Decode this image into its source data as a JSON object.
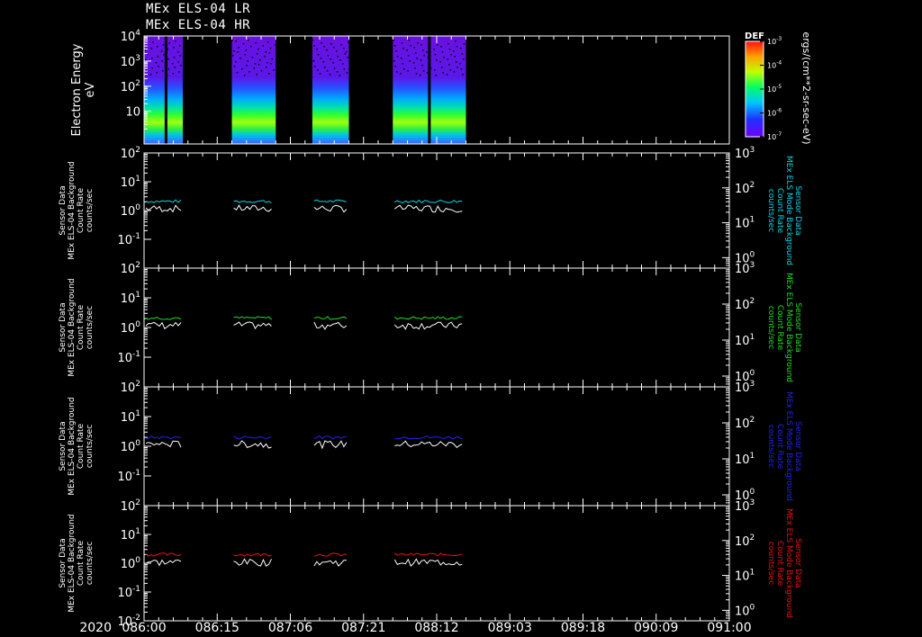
{
  "header": {
    "line1": "MEx ELS-04 LR",
    "line2": "MEx ELS-04 HR"
  },
  "colorbar": {
    "label": "DEF",
    "unit_label": "ergs/(cm**2-sr-sec-eV)",
    "ticks": [
      {
        "base": "10",
        "exp": "-3"
      },
      {
        "base": "10",
        "exp": "-4"
      },
      {
        "base": "10",
        "exp": "-5"
      },
      {
        "base": "10",
        "exp": "-6"
      },
      {
        "base": "10",
        "exp": "-7"
      }
    ]
  },
  "x_axis": {
    "year_label": "2020",
    "ticks": [
      "086:00",
      "086:15",
      "087:06",
      "087:21",
      "088:12",
      "089:03",
      "089:18",
      "090:09",
      "091:00"
    ]
  },
  "chart_data": [
    {
      "type": "heatmap",
      "name": "spectrogram",
      "ylabel_lines": [
        "Electron Energy",
        "eV"
      ],
      "y_ticks": [
        {
          "base": "10",
          "exp": "4"
        },
        {
          "base": "10",
          "exp": "3"
        },
        {
          "base": "10",
          "exp": "2"
        },
        {
          "base": "10",
          "exp": ""
        }
      ],
      "data_blocks": [
        [
          0.0,
          0.53
        ],
        [
          1.2,
          1.8
        ],
        [
          2.3,
          2.8
        ],
        [
          3.4,
          4.4
        ]
      ],
      "gaps_within": [
        0.3,
        3.9
      ]
    },
    {
      "type": "line",
      "name": "panel-cyan",
      "color": "#00d8e8",
      "left_label_lines": [
        "Sensor Data",
        "MEx ELS-04 Background",
        "Count Rate",
        "counts/sec"
      ],
      "right_label_lines": [
        "Sensor Data",
        "MEx ELS Mode Background",
        "Count Rate",
        "counts/sec"
      ],
      "left_ticks": [
        {
          "base": "10",
          "exp": "2"
        },
        {
          "base": "10",
          "exp": "1"
        },
        {
          "base": "10",
          "exp": "0"
        },
        {
          "base": "10",
          "exp": "-1"
        }
      ],
      "right_ticks": [
        {
          "base": "10",
          "exp": "3"
        },
        {
          "base": "10",
          "exp": "2"
        },
        {
          "base": "10",
          "exp": "1"
        },
        {
          "base": "10",
          "exp": "0"
        }
      ],
      "ylim_left": [
        0.01,
        100
      ],
      "level_colored": 2.1,
      "level_white": 1.2
    },
    {
      "type": "line",
      "name": "panel-green",
      "color": "#22dd22",
      "left_label_lines": [
        "Sensor Data",
        "MEx ELS-04 Background",
        "Count Rate",
        "counts/sec"
      ],
      "right_label_lines": [
        "Sensor Data",
        "MEx ELS Mode Background",
        "Count Rate",
        "counts/sec"
      ],
      "left_ticks": [
        {
          "base": "10",
          "exp": "2"
        },
        {
          "base": "10",
          "exp": "1"
        },
        {
          "base": "10",
          "exp": "0"
        },
        {
          "base": "10",
          "exp": "-1"
        }
      ],
      "right_ticks": [
        {
          "base": "10",
          "exp": "3"
        },
        {
          "base": "10",
          "exp": "2"
        },
        {
          "base": "10",
          "exp": "1"
        },
        {
          "base": "10",
          "exp": "0"
        }
      ],
      "ylim_left": [
        0.01,
        100
      ],
      "level_colored": 2.1,
      "level_white": 1.2
    },
    {
      "type": "line",
      "name": "panel-blue",
      "color": "#2222ee",
      "left_label_lines": [
        "Sensor Data",
        "MEx ELS-04 Background",
        "Count Rate",
        "counts/sec"
      ],
      "right_label_lines": [
        "Sensor Data",
        "MEx ELS Mode Background",
        "Count Rate",
        "counts/sec"
      ],
      "left_ticks": [
        {
          "base": "10",
          "exp": "2"
        },
        {
          "base": "10",
          "exp": "1"
        },
        {
          "base": "10",
          "exp": "0"
        },
        {
          "base": "10",
          "exp": "-1"
        }
      ],
      "right_ticks": [
        {
          "base": "10",
          "exp": "3"
        },
        {
          "base": "10",
          "exp": "2"
        },
        {
          "base": "10",
          "exp": "1"
        },
        {
          "base": "10",
          "exp": "0"
        }
      ],
      "ylim_left": [
        0.01,
        100
      ],
      "level_colored": 2.0,
      "level_white": 1.2
    },
    {
      "type": "line",
      "name": "panel-red",
      "color": "#ee1111",
      "left_label_lines": [
        "Sensor Data",
        "MEx ELS-04 Background",
        "Count Rate",
        "counts/sec"
      ],
      "right_label_lines": [
        "Sensor Data",
        "MEx ELS Mode Background",
        "Count Rate",
        "counts/sec"
      ],
      "left_ticks": [
        {
          "base": "10",
          "exp": "2"
        },
        {
          "base": "10",
          "exp": "1"
        },
        {
          "base": "10",
          "exp": "0"
        },
        {
          "base": "10",
          "exp": "-1"
        },
        {
          "base": "10",
          "exp": "-2"
        }
      ],
      "right_ticks": [
        {
          "base": "10",
          "exp": "3"
        },
        {
          "base": "10",
          "exp": "2"
        },
        {
          "base": "10",
          "exp": "1"
        },
        {
          "base": "10",
          "exp": "0"
        }
      ],
      "ylim_left": [
        0.01,
        100
      ],
      "level_colored": 2.0,
      "level_white": 1.1
    }
  ]
}
